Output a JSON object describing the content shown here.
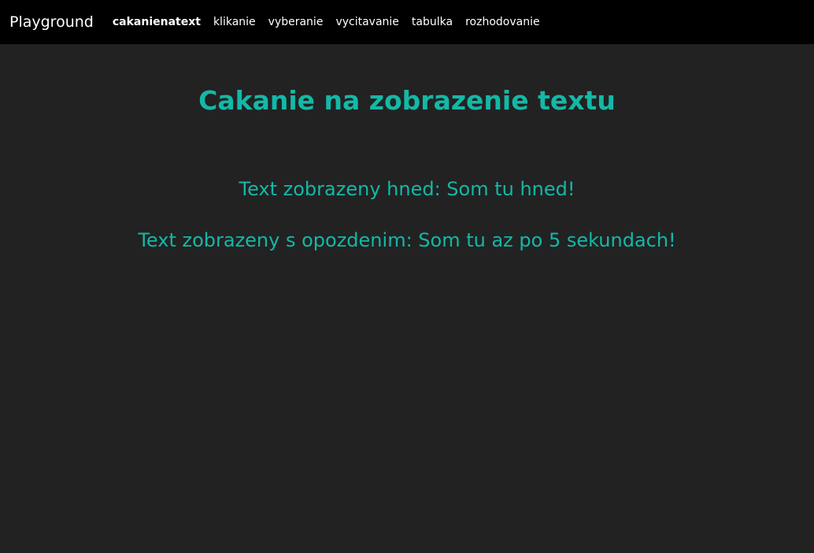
{
  "navbar": {
    "brand": "Playground",
    "links": [
      {
        "label": "cakanienatext",
        "active": true
      },
      {
        "label": "klikanie"
      },
      {
        "label": "vyberanie"
      },
      {
        "label": "vycitavanie"
      },
      {
        "label": "tabulka"
      },
      {
        "label": "rozhodovanie"
      }
    ]
  },
  "main": {
    "title": "Cakanie na zobrazenie textu",
    "immediate_label": "Text zobrazeny hned:",
    "immediate_value": "Som tu hned!",
    "delayed_label": "Text zobrazeny s opozdenim:",
    "delayed_value": "Som tu az po 5 sekundach!"
  },
  "colors": {
    "navbar_bg": "#000000",
    "page_bg": "#222222",
    "accent": "#14b8a6",
    "nav_text": "#ffffff"
  }
}
